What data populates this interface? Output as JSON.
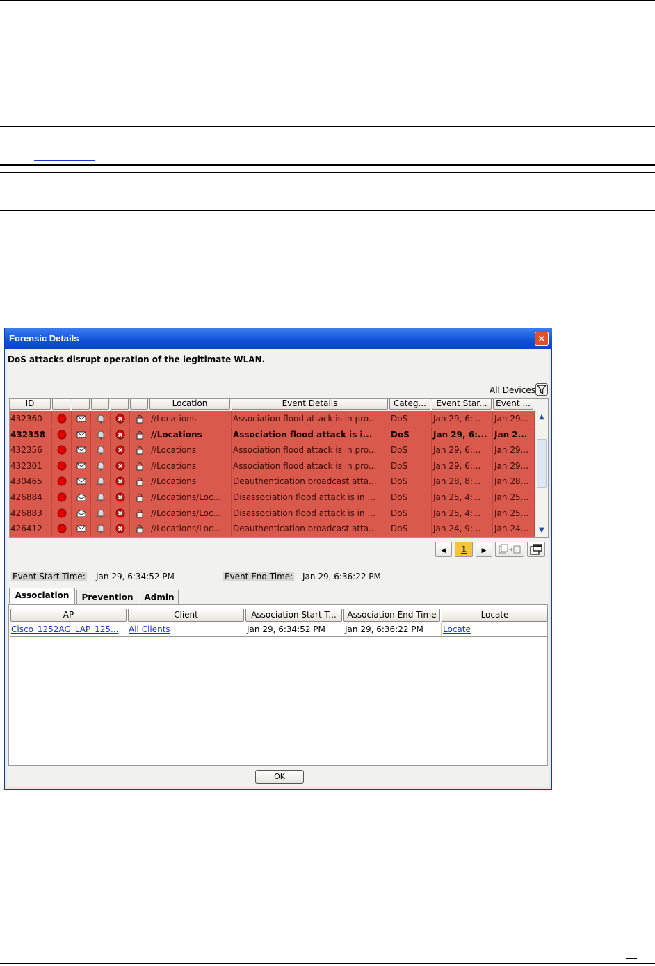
{
  "dialog": {
    "title": "Forensic Details",
    "close_label": "✕",
    "description": "DoS attacks disrupt operation of the legitimate WLAN.",
    "filter_label": "All Devices",
    "columns": [
      "ID",
      "",
      "",
      "",
      "",
      "",
      "Location",
      "Event Details",
      "Categ...",
      "Event Star...",
      "Event ..."
    ],
    "rows": [
      {
        "id": "432360",
        "location": "//Locations",
        "details": "Association flood attack is in pro...",
        "category": "DoS",
        "start": "Jan 29, 6:...",
        "end": "Jan 29...",
        "bold": false,
        "mail": "closed"
      },
      {
        "id": "432358",
        "location": "//Locations",
        "details": "Association flood attack is i...",
        "category": "DoS",
        "start": "Jan 29, 6:...",
        "end": "Jan 2...",
        "bold": true,
        "mail": "closed"
      },
      {
        "id": "432356",
        "location": "//Locations",
        "details": "Association flood attack is in pro...",
        "category": "DoS",
        "start": "Jan 29, 6:...",
        "end": "Jan 29...",
        "bold": false,
        "mail": "closed"
      },
      {
        "id": "432301",
        "location": "//Locations",
        "details": "Association flood attack is in pro...",
        "category": "DoS",
        "start": "Jan 29, 6:...",
        "end": "Jan 29...",
        "bold": false,
        "mail": "closed"
      },
      {
        "id": "430465",
        "location": "//Locations",
        "details": "Deauthentication broadcast atta...",
        "category": "DoS",
        "start": "Jan 28, 8:...",
        "end": "Jan 28...",
        "bold": false,
        "mail": "closed"
      },
      {
        "id": "426884",
        "location": "//Locations/Loc...",
        "details": "Disassociation flood attack is in ...",
        "category": "DoS",
        "start": "Jan 25, 4:...",
        "end": "Jan 25...",
        "bold": false,
        "mail": "open"
      },
      {
        "id": "426883",
        "location": "//Locations/Loc...",
        "details": "Disassociation flood attack is in ...",
        "category": "DoS",
        "start": "Jan 25, 4:...",
        "end": "Jan 25...",
        "bold": false,
        "mail": "open"
      },
      {
        "id": "426412",
        "location": "//Locations/Loc...",
        "details": "Deauthentication broadcast atta...",
        "category": "DoS",
        "start": "Jan 24, 9:...",
        "end": "Jan 24...",
        "bold": false,
        "mail": "closed"
      }
    ],
    "pager": {
      "prev": "◀",
      "current": "1",
      "next": "▶"
    },
    "event_start_label": "Event Start Time:",
    "event_start_value": "Jan 29, 6:34:52 PM",
    "event_end_label": "Event End Time:",
    "event_end_value": "Jan 29, 6:36:22 PM",
    "tabs": [
      "Association",
      "Prevention",
      "Admin"
    ],
    "association": {
      "columns": [
        "AP",
        "Client",
        "Association Start T...",
        "Association End Time",
        "Locate"
      ],
      "row": {
        "ap": "Cisco_1252AG_LAP_125...",
        "client": "All Clients",
        "start": "Jan 29, 6:34:52 PM",
        "end": "Jan 29, 6:36:22 PM",
        "locate": "Locate"
      }
    },
    "ok_label": "OK"
  },
  "colors": {
    "row_bg": "#d9594d",
    "title_bar": "#0d52d8",
    "current_page": "#f4c53a",
    "link": "#1a2fd4"
  }
}
